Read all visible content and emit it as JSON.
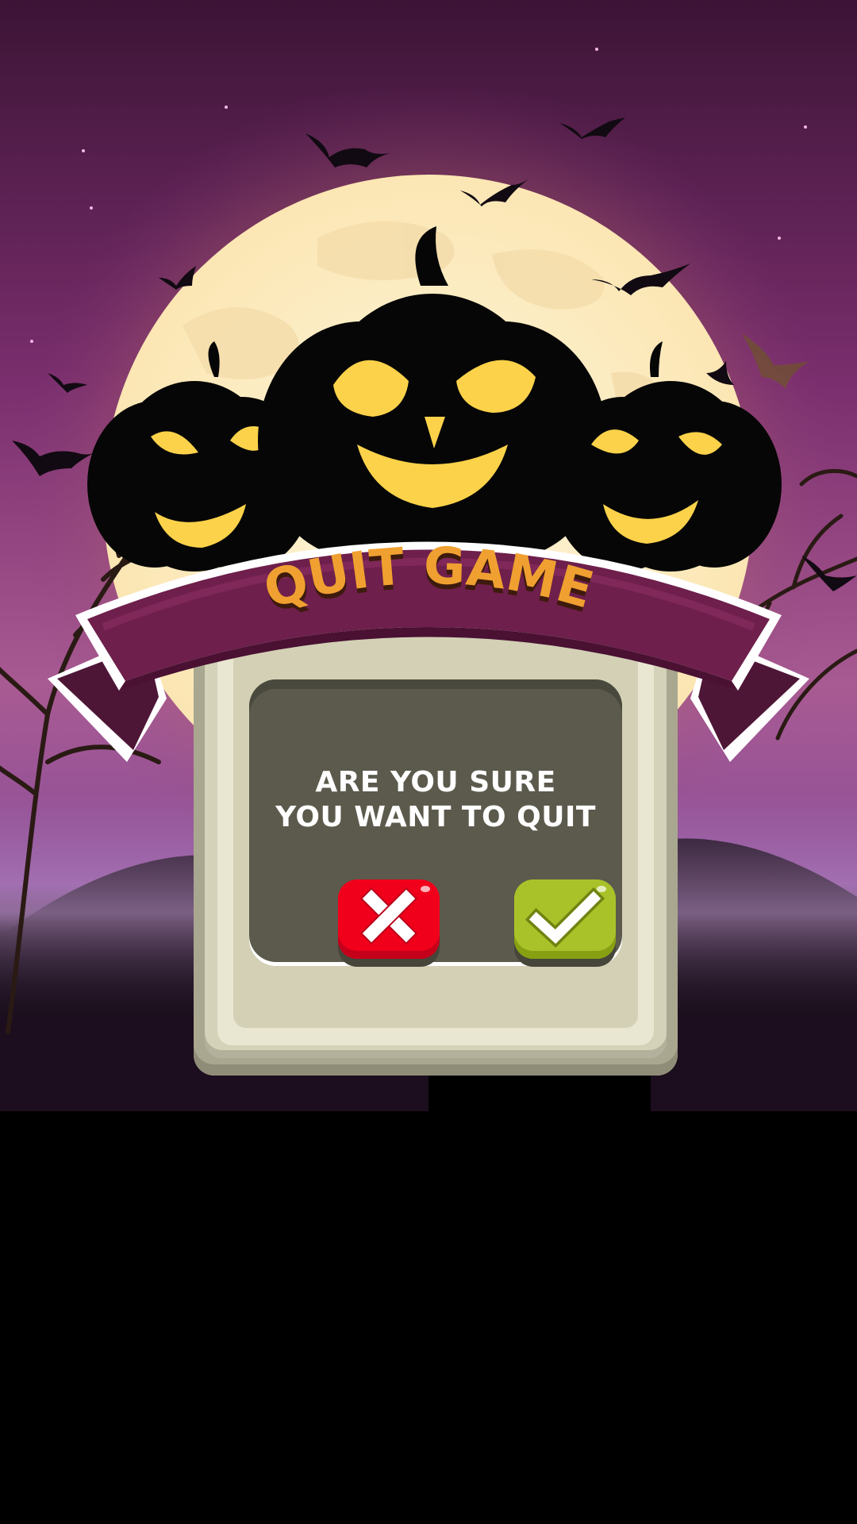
{
  "dialog": {
    "title": "QUIT GAME",
    "question": "ARE YOU SURE\nYOU WANT TO QUIT"
  },
  "buttons": {
    "cancel_icon": "close-icon",
    "confirm_icon": "checkmark-icon"
  },
  "colors": {
    "sky_top": "#3c1436",
    "sky_mid": "#8a3d7e",
    "moon": "#fdf0cc",
    "ribbon": "#6e1f4b",
    "title": "#f0a030",
    "panel_dark": "#5b5a4c",
    "cancel_red": "#f1001b",
    "confirm_green": "#a9c22a"
  }
}
